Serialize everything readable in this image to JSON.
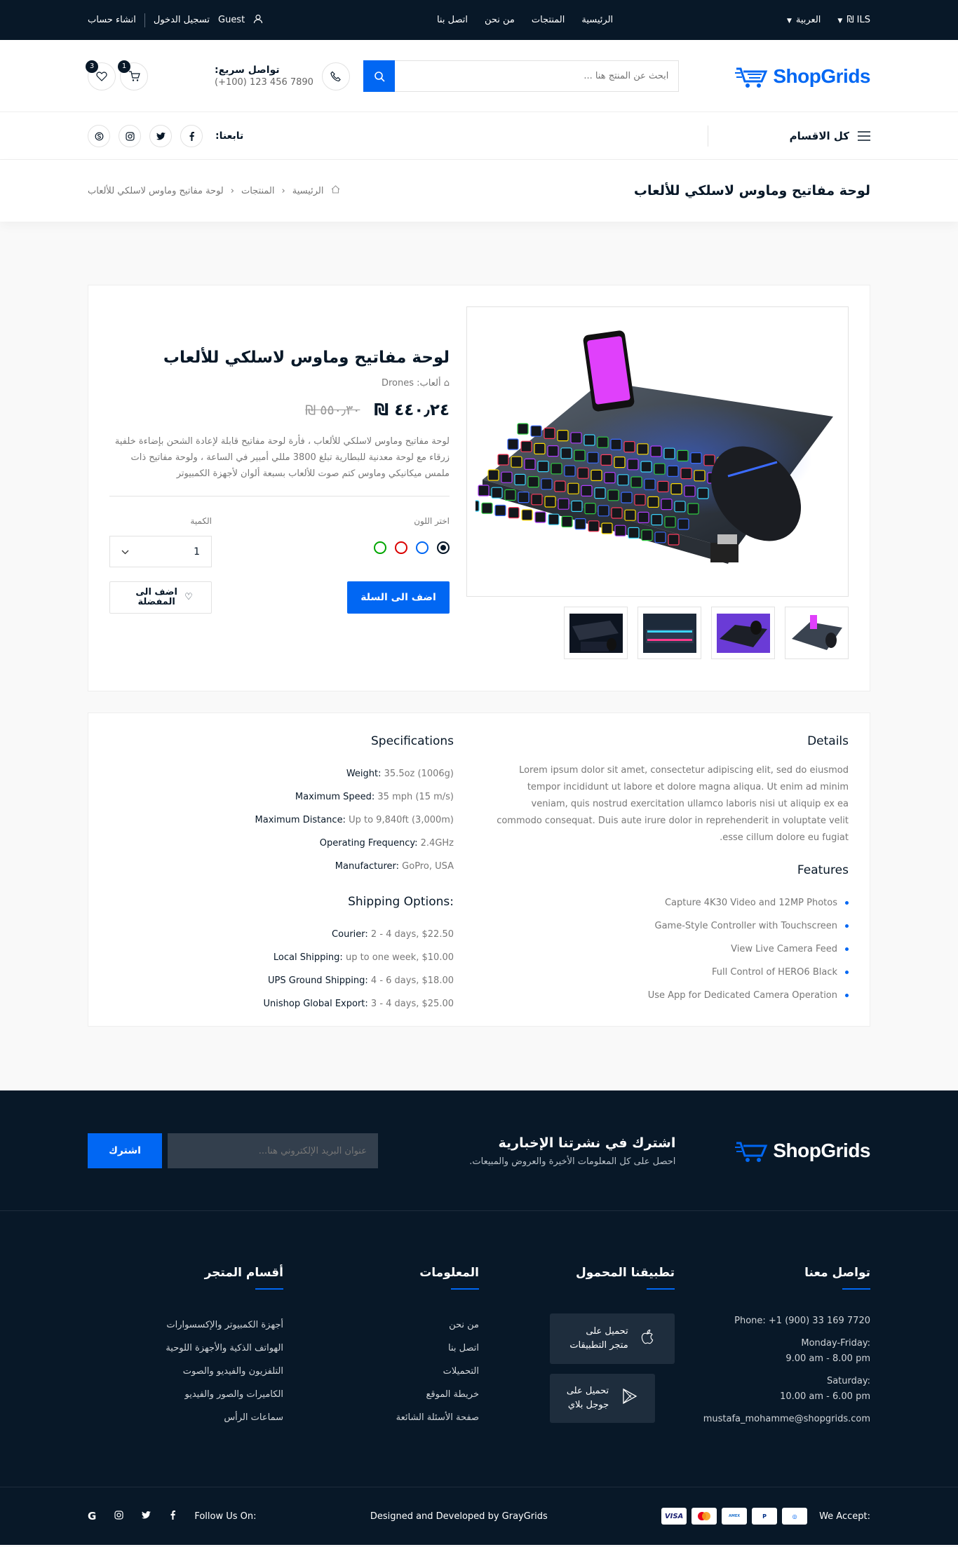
{
  "topbar": {
    "currency": "ILS ₪",
    "language": "العربية",
    "nav": [
      "الرئيسية",
      "المنتجات",
      "من نحن",
      "اتصل بنا"
    ],
    "guest": "Guest",
    "login": "تسجيل الدخول",
    "register": "انشاء حساب"
  },
  "header": {
    "logo": "ShopGrids",
    "search_placeholder": "ابحث عن المنتج هنا ...",
    "hotline_title": "تواصل سريع:",
    "hotline_number": "(+100) 123 456 7890",
    "wishlist_count": "3",
    "cart_count": "1"
  },
  "catbar": {
    "all_categories": "كل الاقسام",
    "follow_label": "تابعنا:"
  },
  "breadcrumb": {
    "title": "لوحة مفاتيح وماوس لاسلكي للألعاب",
    "home": "الرئيسية",
    "products": "المنتجات",
    "current": "لوحة مفاتيح وماوس لاسلكي للألعاب"
  },
  "product": {
    "name": "لوحة مفاتيح وماوس لاسلكي للألعاب",
    "category_label": "ألعاب:",
    "category_value": "Drones",
    "price": "٤٤٠٫٢٤ ₪",
    "old_price": "٥٥٠٫٣٠ ₪",
    "description": "لوحة مفاتيح وماوس لاسلكي للألعاب ، فأرة لوحة مفاتيح قابلة لإعادة الشحن بإضاءة خلفية زرقاء مع لوحة معدنية للبطارية تبلغ 3800 مللي أمبير في الساعة ، ولوحة مفاتيح ذات ملمس ميكانيكي وماوس كتم صوت للألعاب بسبعة ألوان لأجهزة الكمبيوتر",
    "color_label": "اختر اللون",
    "colors": [
      "#081828",
      "#0167f3",
      "#da0000",
      "#00a600"
    ],
    "quantity_label": "الكمية",
    "quantity_value": "1",
    "add_to_cart": "اضف الى السلة",
    "add_to_wishlist": "اضف الى المفضلة"
  },
  "details": {
    "details_title": "Details",
    "details_text": "Lorem ipsum dolor sit amet, consectetur adipiscing elit, sed do eiusmod tempor incididunt ut labore et dolore magna aliqua. Ut enim ad minim veniam, quis nostrud exercitation ullamco laboris nisi ut aliquip ex ea commodo consequat. Duis aute irure dolor in reprehenderit in voluptate velit esse cillum dolore eu fugiat.",
    "features_title": "Features",
    "features": [
      "Capture 4K30 Video and 12MP Photos",
      "Game-Style Controller with Touchscreen",
      "View Live Camera Feed",
      "Full Control of HERO6 Black",
      "Use App for Dedicated Camera Operation"
    ],
    "specs_title": "Specifications",
    "specs": [
      {
        "label": "Weight:",
        "value": "35.5oz (1006g)"
      },
      {
        "label": "Maximum Speed:",
        "value": "35 mph (15 m/s)"
      },
      {
        "label": "Maximum Distance:",
        "value": "Up to 9,840ft (3,000m)"
      },
      {
        "label": "Operating Frequency:",
        "value": "2.4GHz"
      },
      {
        "label": "Manufacturer:",
        "value": "GoPro, USA"
      }
    ],
    "shipping_title": "Shipping Options:",
    "shipping": [
      {
        "label": "Courier:",
        "value": "2 - 4 days, $22.50"
      },
      {
        "label": "Local Shipping:",
        "value": "up to one week, $10.00"
      },
      {
        "label": "UPS Ground Shipping:",
        "value": "4 - 6 days, $18.00"
      },
      {
        "label": "Unishop Global Export:",
        "value": "3 - 4 days, $25.00"
      }
    ]
  },
  "footer": {
    "logo": "ShopGrids",
    "newsletter_title": "اشترك في نشرتنا الإخبارية",
    "newsletter_text": "احصل على كل المعلومات الأخيرة والعروض والمبيعات.",
    "email_placeholder": "عنوان البريد الإلكتروني هنا...",
    "subscribe": "اشترك",
    "contact_title": "تواصل معنا",
    "contact": [
      "Phone: +1 (900) 33 169 7720",
      "Monday-Friday:",
      "9.00 am - 8.00 pm",
      "Saturday:",
      "10.00 am - 6.00 pm",
      "mustafa_mohamme@shopgrids.com"
    ],
    "apps_title": "تطبيقنا المحمول",
    "app_store": "تحميل على\nمتجر التطبيقات",
    "google_play": "تحميل على\nجوجل بلاي",
    "info_title": "المعلومات",
    "info": [
      "من نحن",
      "اتصل بنا",
      "التحميلات",
      "خريطة الموقع",
      "صفحة الأسئلة الشائعة"
    ],
    "shop_title": "أقسام المتجر",
    "shop": [
      "أجهزة الكمبيوتر والإكسسوارات",
      "الهواتف الذكية والأجهزة اللوحية",
      "التلفزيون والفيديو والصوت",
      "الكاميرات والصور والفيديو",
      "سماعات الرأس"
    ],
    "we_accept": "We Accept:",
    "credit": "Designed and Developed by GrayGrids",
    "follow_us": "Follow Us On:"
  }
}
